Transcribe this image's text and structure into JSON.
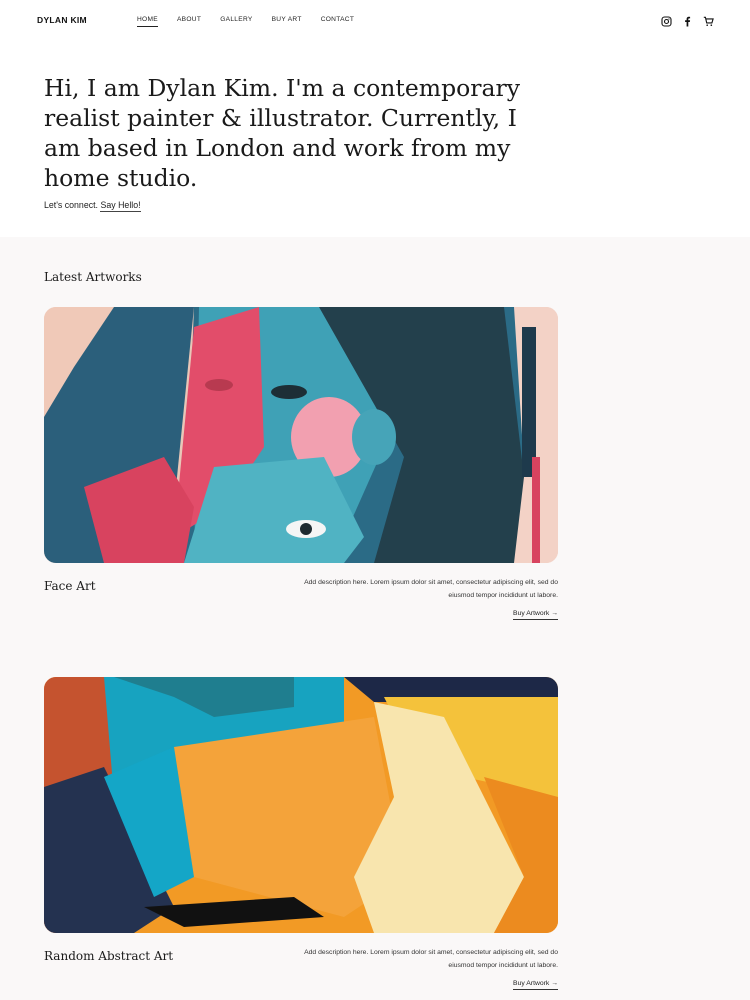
{
  "header": {
    "brand": "DYLAN KIM",
    "nav": [
      "HOME",
      "ABOUT",
      "GALLERY",
      "BUY ART",
      "CONTACT"
    ],
    "icons": [
      "instagram-icon",
      "facebook-icon",
      "cart-icon"
    ]
  },
  "hero": {
    "text": "Hi, I am Dylan Kim. I'm a contemporary realist painter & illustrator. Currently, I am based in London and work from my home studio.",
    "connect_prefix": "Let's connect.",
    "connect_link": "Say Hello!"
  },
  "artworks": {
    "title": "Latest Artworks",
    "items": [
      {
        "name": "Face Art",
        "description": "Add description here. Lorem ipsum dolor sit amet, consectetur adipiscing elit, sed do eiusmod tempor incididunt ut labore.",
        "cta": "Buy Artwork →"
      },
      {
        "name": "Random Abstract Art",
        "description": "Add description here. Lorem ipsum dolor sit amet, consectetur adipiscing elit, sed do eiusmod tempor incididunt ut labore.",
        "cta": "Buy Artwork →"
      }
    ]
  }
}
